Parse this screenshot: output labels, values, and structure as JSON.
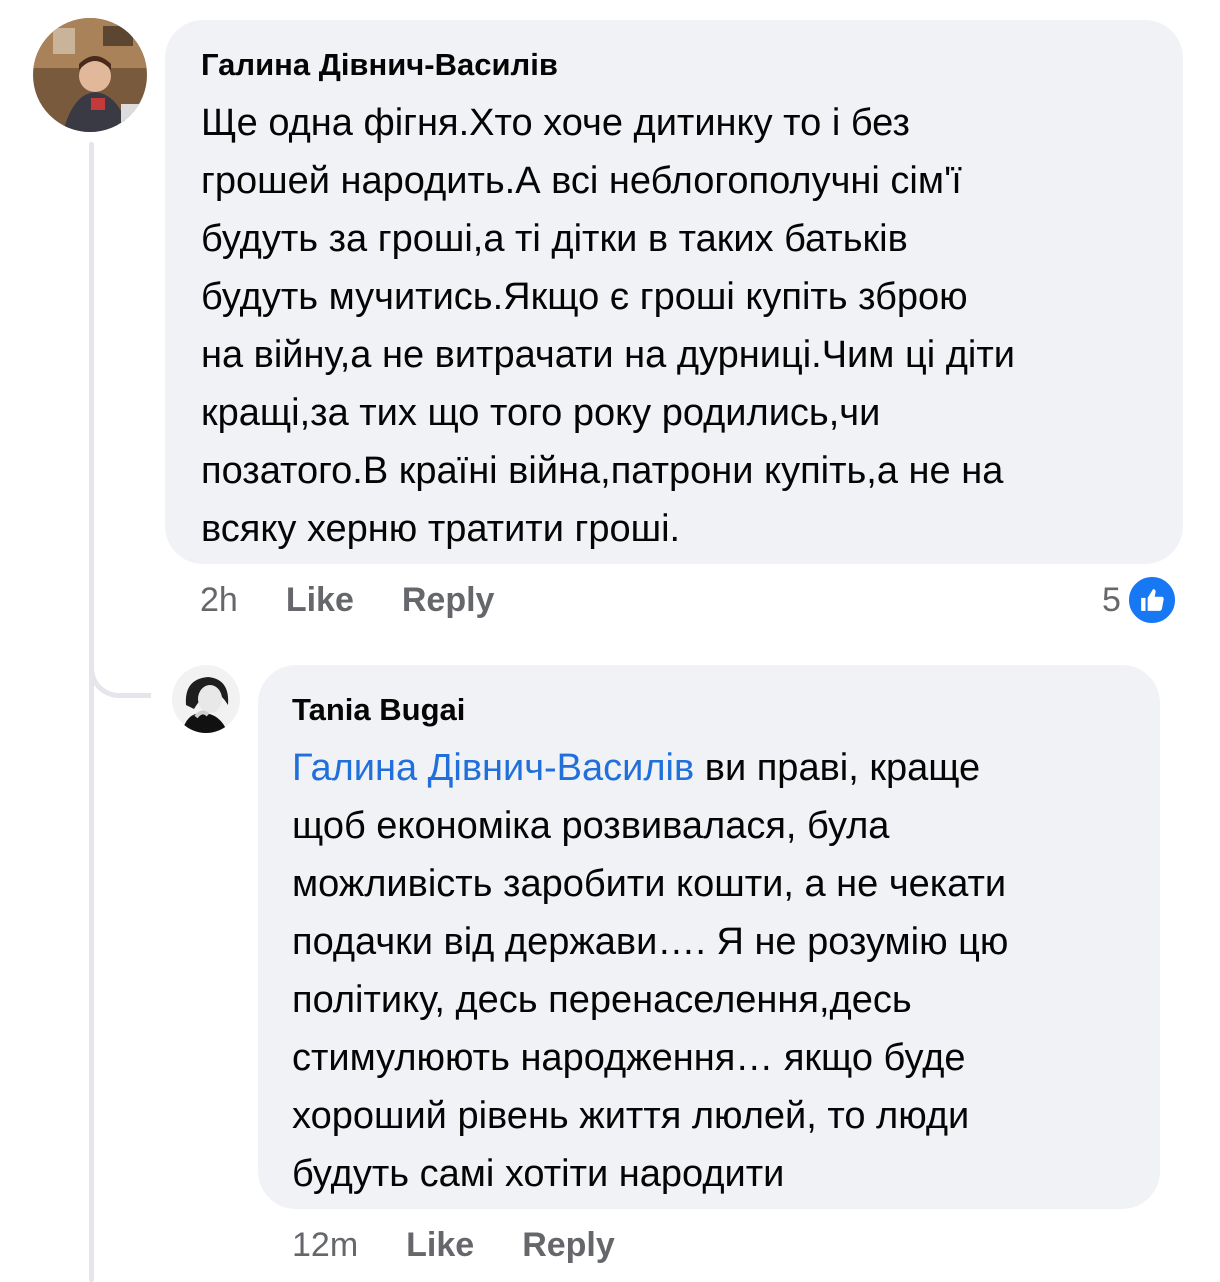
{
  "comments": [
    {
      "author": "Галина Дівнич-Василів",
      "text": "Ще одна фігня.Хто хоче дитинку то і без\nгрошей народить.А всі неблогополучні сім'ї\nбудуть за гроші,а ті дітки в таких батьків\nбудуть мучитись.Якщо є гроші купіть зброю\nна війну,а не витрачати на дурниці.Чим ці діти\nкращі,за тих що того року родились,чи\nпозатого.В країні війна,патрони купіть,а не на\nвсяку херню тратити гроші.",
      "time": "2h",
      "like_label": "Like",
      "reply_label": "Reply",
      "reaction_count": "5",
      "reaction_icon": "like-icon",
      "accent": "#1877f2"
    },
    {
      "author": "Tania Bugai",
      "mention": "Галина Дівнич-Василів",
      "text": " ви праві, краще\nщоб економіка розвивалася, була\nможливість заробити кошти, а не чекати\nподачки від держави…. Я не розумію цю\nполітику, десь перенаселення,десь\nстимулюють народження… якщо буде\nхороший рівень життя люлей, то люди\nбудуть самі хотіти народити",
      "time": "12m",
      "like_label": "Like",
      "reply_label": "Reply",
      "mention_color": "#216fdb"
    }
  ]
}
